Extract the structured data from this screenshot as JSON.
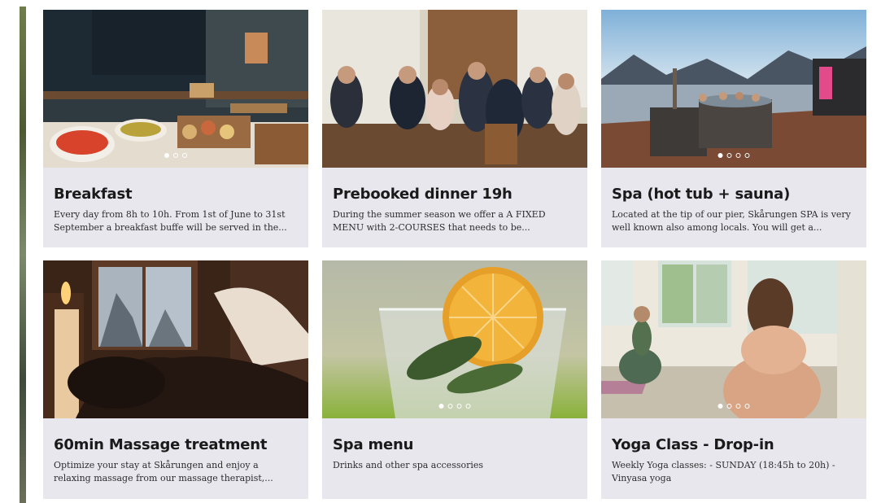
{
  "cards": [
    {
      "title": "Breakfast",
      "description": "Every day from 8h to 10h. From 1st of June to 31st September a breakfast buffe will be served in the...",
      "photo": "breakfast-buffet",
      "carousel": {
        "total": 3,
        "active": 1
      }
    },
    {
      "title": "Prebooked dinner 19h",
      "description": "During the summer season we offer a A FIXED MENU with 2-COURSES that needs to be...",
      "photo": "dinner-party",
      "carousel": {
        "total": 0,
        "active": 0
      }
    },
    {
      "title": "Spa (hot tub + sauna)",
      "description": "Located at the tip of our pier, Skårungen SPA is very well known also among locals. You will get a...",
      "photo": "hot-tub-pier",
      "carousel": {
        "total": 4,
        "active": 1
      }
    },
    {
      "title": "60min Massage treatment",
      "description": "Optimize your stay at Skårungen and enjoy a relaxing massage from our massage therapist,...",
      "photo": "massage-room",
      "carousel": {
        "total": 0,
        "active": 0
      }
    },
    {
      "title": "Spa menu",
      "description": "Drinks and other spa accessories",
      "photo": "orange-drink",
      "carousel": {
        "total": 4,
        "active": 1
      }
    },
    {
      "title": "Yoga Class - Drop-in",
      "description": "Weekly Yoga classes: - SUNDAY (18:45h to 20h) - Vinyasa yoga",
      "photo": "yoga-class",
      "carousel": {
        "total": 4,
        "active": 1
      }
    }
  ],
  "colors": {
    "card_bg": "#e8e7ee",
    "title": "#1a1a1a",
    "text": "#2d2d2d"
  }
}
